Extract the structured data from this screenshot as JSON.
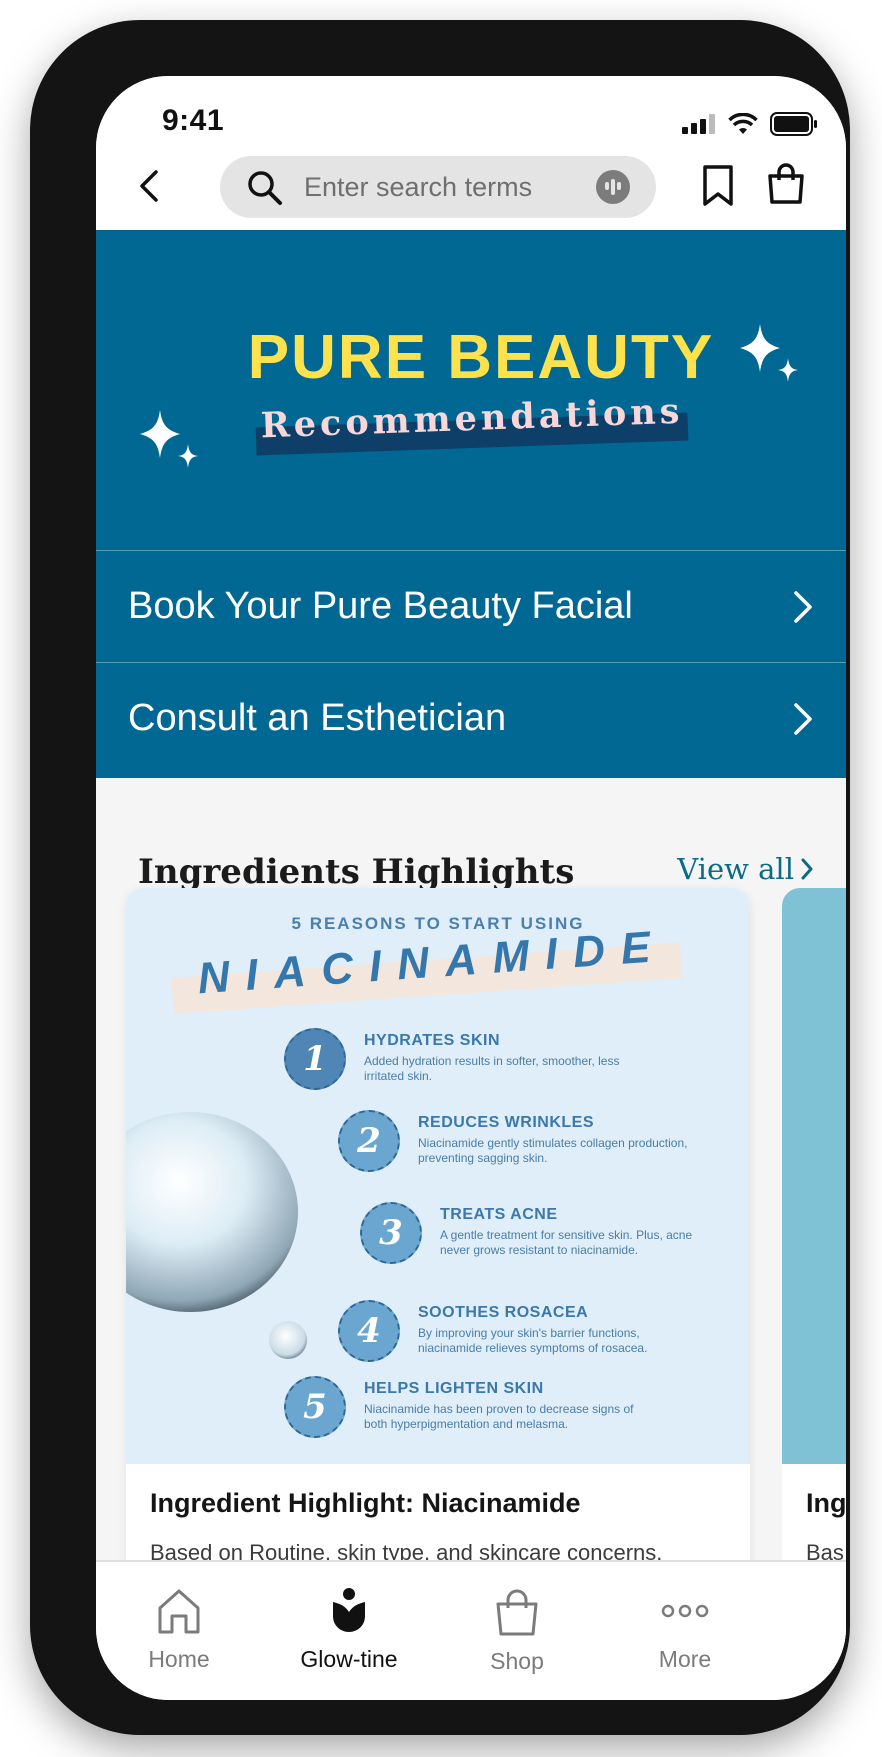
{
  "status": {
    "time": "9:41"
  },
  "search": {
    "placeholder": "Enter search terms"
  },
  "hero": {
    "title": "PURE BEAUTY",
    "subtitle": "Recommendations"
  },
  "rows": [
    {
      "label": "Book Your Pure Beauty Facial"
    },
    {
      "label": "Consult an Esthetician"
    }
  ],
  "highlights": {
    "title": "Ingredients Highlights",
    "view_all": "View all",
    "cards": [
      {
        "kicker": "5 REASONS TO START USING",
        "headline": "NIACINAMIDE",
        "reasons": [
          {
            "number": "1",
            "title": "HYDRATES SKIN",
            "text": "Added hydration results in softer, smoother, less irritated skin."
          },
          {
            "number": "2",
            "title": "REDUCES WRINKLES",
            "text": "Niacinamide gently stimulates collagen production, preventing sagging skin."
          },
          {
            "number": "3",
            "title": "TREATS ACNE",
            "text": "A gentle treatment for sensitive skin. Plus, acne never grows resistant to niacinamide."
          },
          {
            "number": "4",
            "title": "SOOTHES ROSACEA",
            "text": "By improving your skin's barrier functions, niacinamide relieves symptoms of rosacea."
          },
          {
            "number": "5",
            "title": "HELPS LIGHTEN SKIN",
            "text": "Niacinamide has been proven to decrease signs of both hyperpigmentation and melasma."
          }
        ],
        "title": "Ingredient Highlight: Niacinamide",
        "description": "Based on Routine, skin type, and skincare concerns,"
      },
      {
        "title": "Ing",
        "description": "Bas"
      }
    ]
  },
  "nav": [
    {
      "label": "Home",
      "icon": "home-icon"
    },
    {
      "label": "Glow-tine",
      "icon": "tulip-icon"
    },
    {
      "label": "Shop",
      "icon": "shopping-bag-icon"
    },
    {
      "label": "More",
      "icon": "more-dots-icon"
    }
  ],
  "colors": {
    "primary": "#006893",
    "accent_yellow": "#fde24d",
    "card_art": "#dfeef8",
    "card2_art": "#7fc1d5"
  }
}
